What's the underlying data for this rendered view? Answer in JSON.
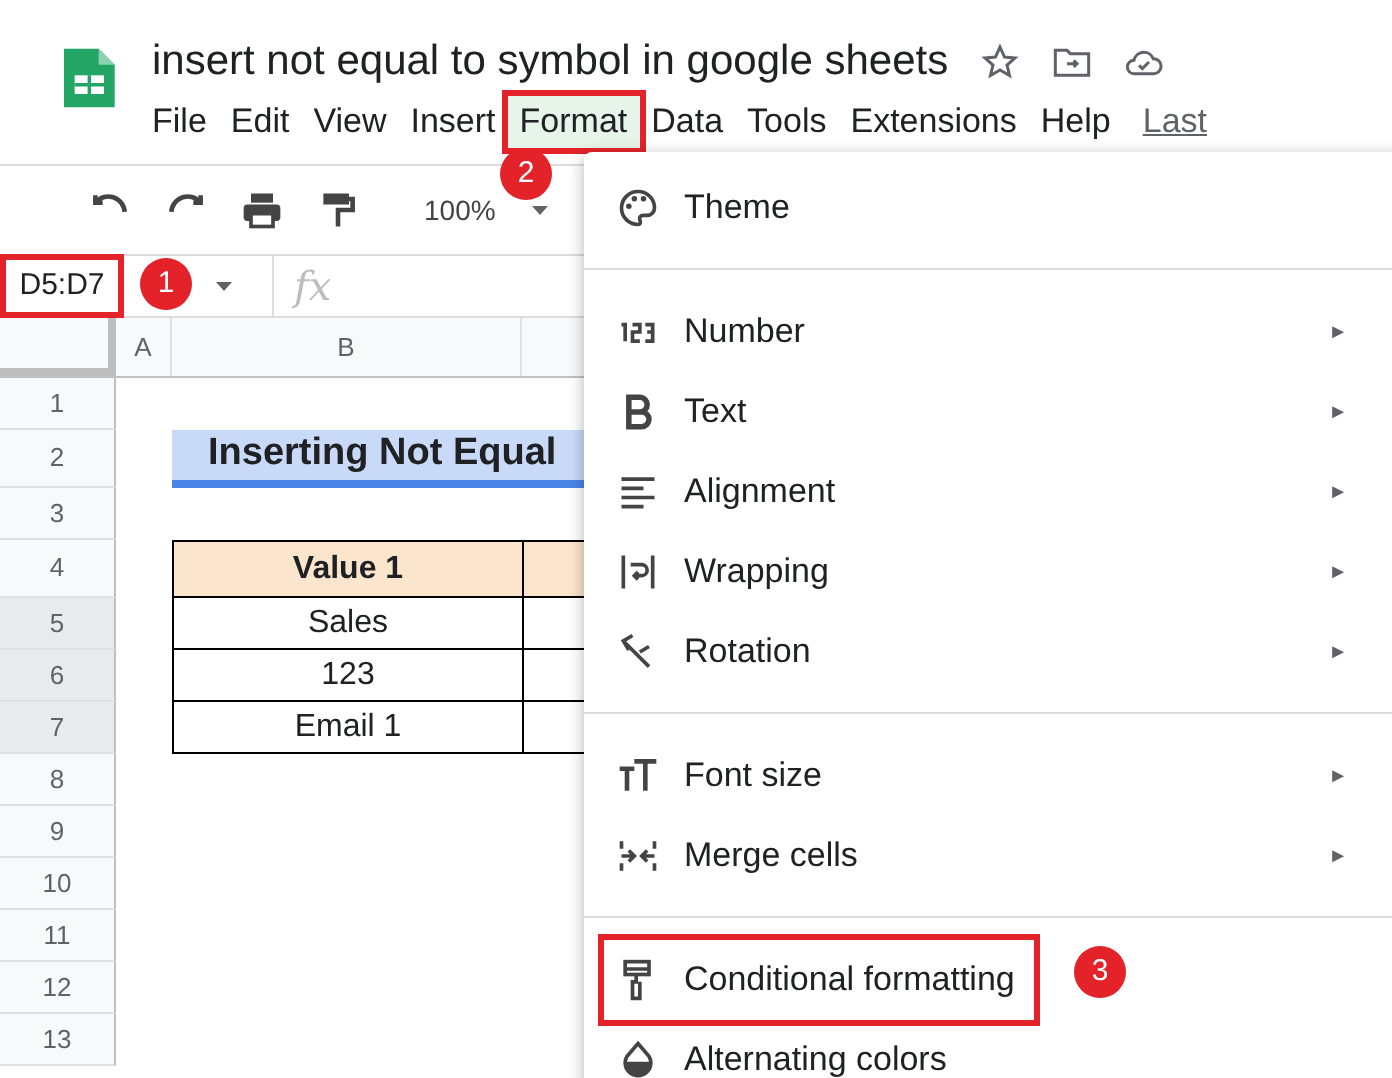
{
  "document": {
    "title": "insert not equal to symbol in google sheets"
  },
  "menubar": [
    {
      "label": "File",
      "selected": false
    },
    {
      "label": "Edit",
      "selected": false
    },
    {
      "label": "View",
      "selected": false
    },
    {
      "label": "Insert",
      "selected": false
    },
    {
      "label": "Format",
      "selected": true
    },
    {
      "label": "Data",
      "selected": false
    },
    {
      "label": "Tools",
      "selected": false
    },
    {
      "label": "Extensions",
      "selected": false
    },
    {
      "label": "Help",
      "selected": false
    }
  ],
  "last_edit_link": "Last",
  "toolbar": {
    "zoom": "100%"
  },
  "formula_bar": {
    "name_box": "D5:D7",
    "fx": "fx"
  },
  "columns": [
    "A",
    "B"
  ],
  "rows": [
    {
      "number": "1",
      "selected": false
    },
    {
      "number": "2",
      "selected": false
    },
    {
      "number": "3",
      "selected": false
    },
    {
      "number": "4",
      "selected": false
    },
    {
      "number": "5",
      "selected": true
    },
    {
      "number": "6",
      "selected": true
    },
    {
      "number": "7",
      "selected": true
    },
    {
      "number": "8",
      "selected": false
    },
    {
      "number": "9",
      "selected": false
    },
    {
      "number": "10",
      "selected": false
    },
    {
      "number": "11",
      "selected": false
    },
    {
      "number": "12",
      "selected": false
    },
    {
      "number": "13",
      "selected": false
    }
  ],
  "sheet": {
    "heading": "Inserting Not Equal",
    "table_header": "Value 1",
    "values": [
      "Sales",
      "123",
      "Email 1"
    ]
  },
  "format_menu": [
    [
      {
        "label": "Theme",
        "submenu": false,
        "disabled": false
      }
    ],
    [
      {
        "label": "Number",
        "submenu": true,
        "disabled": false
      },
      {
        "label": "Text",
        "submenu": true,
        "disabled": false
      },
      {
        "label": "Alignment",
        "submenu": true,
        "disabled": false
      },
      {
        "label": "Wrapping",
        "submenu": true,
        "disabled": false
      },
      {
        "label": "Rotation",
        "submenu": true,
        "disabled": false
      }
    ],
    [
      {
        "label": "Font size",
        "submenu": true,
        "disabled": false
      },
      {
        "label": "Merge cells",
        "submenu": true,
        "disabled": false
      }
    ],
    [
      {
        "label": "Conditional formatting",
        "submenu": false,
        "disabled": false,
        "outlined": true
      },
      {
        "label": "Alternating colors",
        "submenu": false,
        "disabled": false,
        "outlined": false
      }
    ]
  ],
  "submenu_arrow": "►",
  "step_markers": [
    "1",
    "2",
    "3"
  ]
}
